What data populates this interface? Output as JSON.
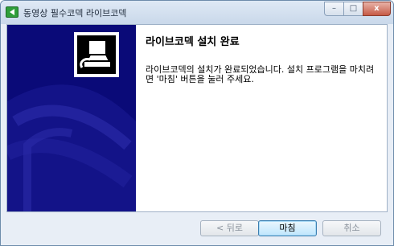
{
  "window": {
    "title": "동영상 필수코덱 라이브코덱"
  },
  "titlebar": {
    "minimize_glyph": "–",
    "maximize_glyph": "□",
    "close_glyph": "x"
  },
  "content": {
    "heading": "라이브코덱 설치 완료",
    "body": "라이브코덱의 설치가 완료되었습니다. 설치 프로그램을 마치려면 '마침' 버튼을 눌러 주세요."
  },
  "buttons": {
    "back": "< 뒤로",
    "finish": "마침",
    "cancel": "취소"
  },
  "colors": {
    "sidebar": "#0a0a78",
    "accent": "#3c7fb1"
  }
}
